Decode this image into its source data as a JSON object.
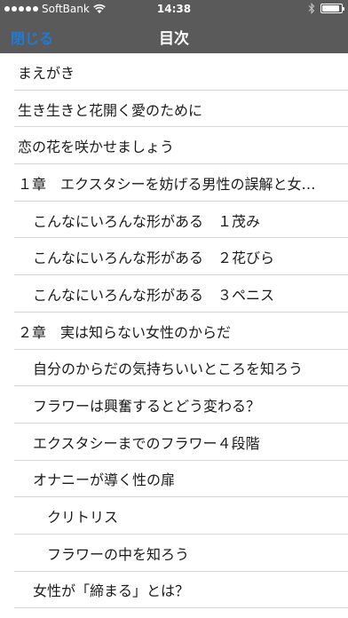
{
  "status_bar": {
    "carrier": "SoftBank",
    "time": "14:38",
    "battery_percent": 90,
    "signal_bars": 5
  },
  "nav": {
    "close_label": "閉じる",
    "title": "目次"
  },
  "toc": [
    {
      "label": "まえがき",
      "level": 0
    },
    {
      "label": "生き生きと花開く愛のために",
      "level": 0
    },
    {
      "label": "恋の花を咲かせましょう",
      "level": 0
    },
    {
      "label": "１章　エクスタシーを妨げる男性の誤解と女…",
      "level": 0
    },
    {
      "label": "こんなにいろんな形がある　１茂み",
      "level": 1
    },
    {
      "label": "こんなにいろんな形がある　２花びら",
      "level": 1
    },
    {
      "label": "こんなにいろんな形がある　３ペニス",
      "level": 1
    },
    {
      "label": "２章　実は知らない女性のからだ",
      "level": 0
    },
    {
      "label": "自分のからだの気持ちいいところを知ろう",
      "level": 1
    },
    {
      "label": "フラワーは興奮するとどう変わる？",
      "level": 1
    },
    {
      "label": "エクスタシーまでのフラワー４段階",
      "level": 1
    },
    {
      "label": "オナニーが導く性の扉",
      "level": 1
    },
    {
      "label": "クリトリス",
      "level": 2
    },
    {
      "label": "フラワーの中を知ろう",
      "level": 2
    },
    {
      "label": "女性が「締まる」とは？",
      "level": 1
    }
  ]
}
